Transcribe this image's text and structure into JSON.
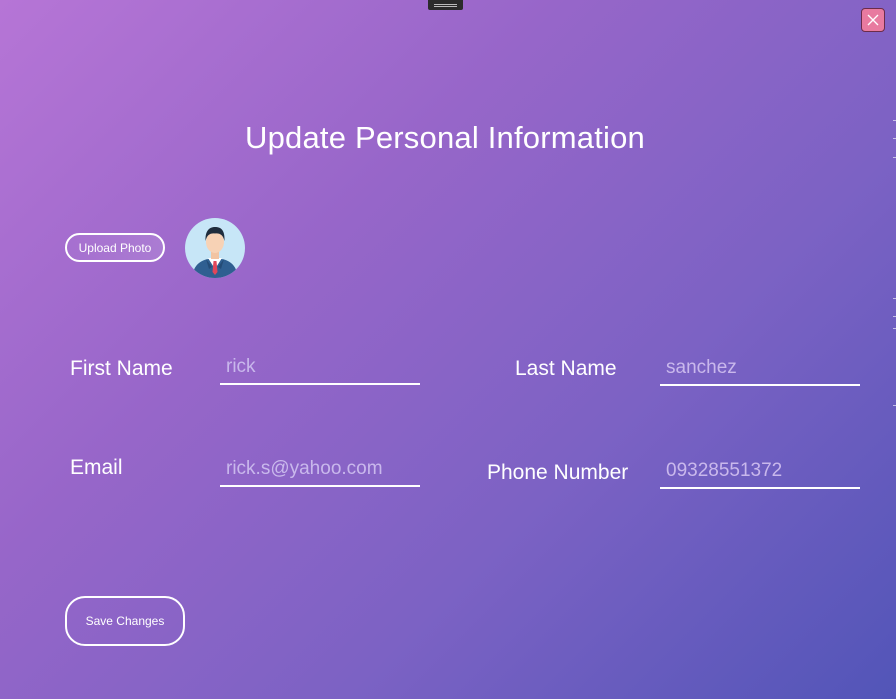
{
  "window": {
    "close_icon": "close-icon",
    "drag_handle_icon": "drag-handle-icon",
    "accent_colors": {
      "gradient_start": "#b675d6",
      "gradient_end": "#5255b8",
      "close_bg": "#e87aa0"
    }
  },
  "header": {
    "title": "Update Personal Information"
  },
  "photo": {
    "upload_label": "Upload Photo",
    "avatar_icon": "user-avatar-icon"
  },
  "form": {
    "first_name": {
      "label": "First Name",
      "value": "rick"
    },
    "last_name": {
      "label": "Last Name",
      "value": "sanchez"
    },
    "email": {
      "label": "Email",
      "value": "rick.s@yahoo.com"
    },
    "phone": {
      "label": "Phone Number",
      "value": "09328551372"
    }
  },
  "actions": {
    "save_label": "Save Changes"
  }
}
